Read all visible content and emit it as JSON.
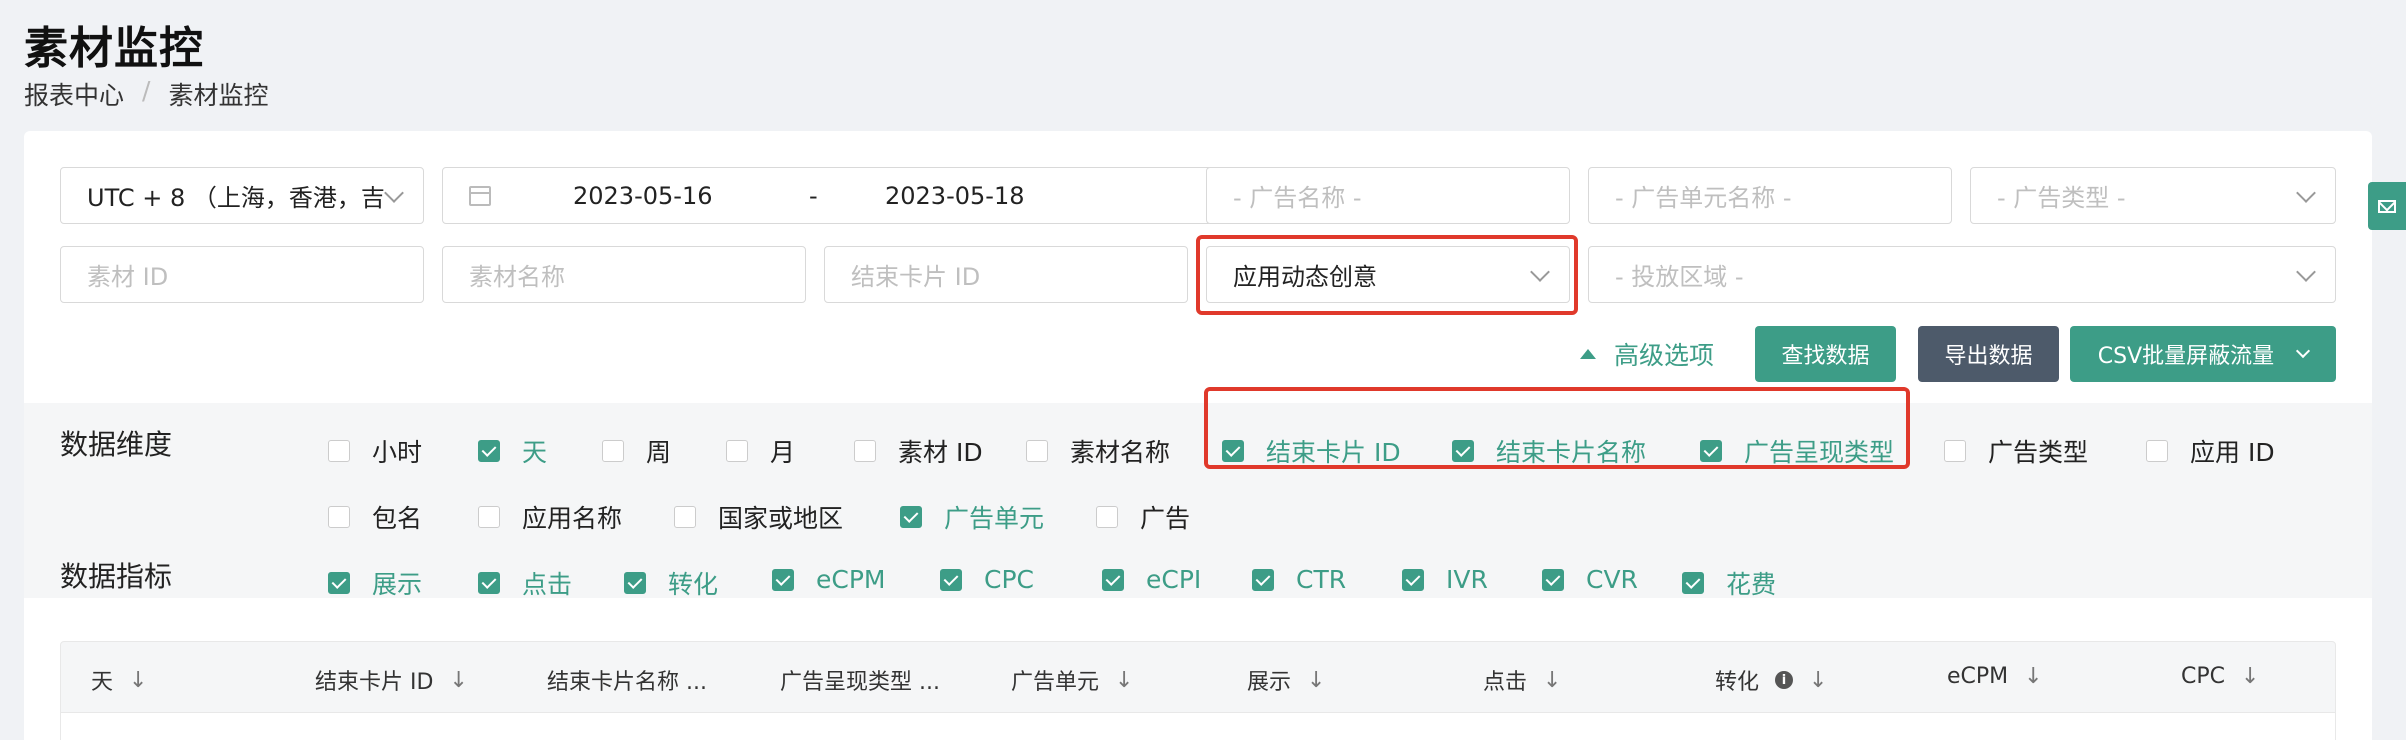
{
  "page": {
    "title": "素材监控"
  },
  "breadcrumb": {
    "items": [
      "报表中心",
      "素材监控"
    ],
    "separator": "/"
  },
  "filters": {
    "timezone": "UTC + 8 （上海，香港，吉",
    "date_start": "2023-05-16",
    "date_separator": "-",
    "date_end": "2023-05-18",
    "ad_name_placeholder": "- 广告名称 -",
    "ad_unit_name_placeholder": "- 广告单元名称 -",
    "ad_type_placeholder": "- 广告类型 -",
    "material_id_placeholder": "素材 ID",
    "material_name_placeholder": "素材名称",
    "end_card_id_placeholder": "结束卡片 ID",
    "creative_type_value": "应用动态创意",
    "region_placeholder": "- 投放区域 -"
  },
  "actions": {
    "advanced": "高级选项",
    "search": "查找数据",
    "export": "导出数据",
    "csv_block": "CSV批量屏蔽流量"
  },
  "dimensions": {
    "label": "数据维度",
    "items": [
      {
        "label": "小时",
        "checked": false
      },
      {
        "label": "天",
        "checked": true
      },
      {
        "label": "周",
        "checked": false
      },
      {
        "label": "月",
        "checked": false
      },
      {
        "label": "素材 ID",
        "checked": false
      },
      {
        "label": "素材名称",
        "checked": false
      },
      {
        "label": "结束卡片 ID",
        "checked": true
      },
      {
        "label": "结束卡片名称",
        "checked": true
      },
      {
        "label": "广告呈现类型",
        "checked": true
      },
      {
        "label": "广告类型",
        "checked": false
      },
      {
        "label": "应用 ID",
        "checked": false
      },
      {
        "label": "包名",
        "checked": false
      },
      {
        "label": "应用名称",
        "checked": false
      },
      {
        "label": "国家或地区",
        "checked": false
      },
      {
        "label": "广告单元",
        "checked": true
      },
      {
        "label": "广告",
        "checked": false
      }
    ]
  },
  "metrics": {
    "label": "数据指标",
    "items": [
      {
        "label": "展示",
        "checked": true
      },
      {
        "label": "点击",
        "checked": true
      },
      {
        "label": "转化",
        "checked": true
      },
      {
        "label": "eCPM",
        "checked": true
      },
      {
        "label": "CPC",
        "checked": true
      },
      {
        "label": "eCPI",
        "checked": true
      },
      {
        "label": "CTR",
        "checked": true
      },
      {
        "label": "IVR",
        "checked": true
      },
      {
        "label": "CVR",
        "checked": true
      },
      {
        "label": "花费",
        "checked": true
      }
    ]
  },
  "table": {
    "sort_glyph": "↓",
    "info_glyph": "i",
    "columns": [
      "天",
      "结束卡片 ID",
      "结束卡片名称 ...",
      "广告呈现类型 ...",
      "广告单元",
      "展示",
      "点击",
      "转化",
      "eCPM",
      "CPC"
    ]
  },
  "colors": {
    "accent": "#3d9d87",
    "highlight": "#e0392b",
    "dark_button": "#4d5a6a"
  },
  "icons": {
    "calendar": "calendar-icon",
    "side_tab": "mail-icon"
  }
}
